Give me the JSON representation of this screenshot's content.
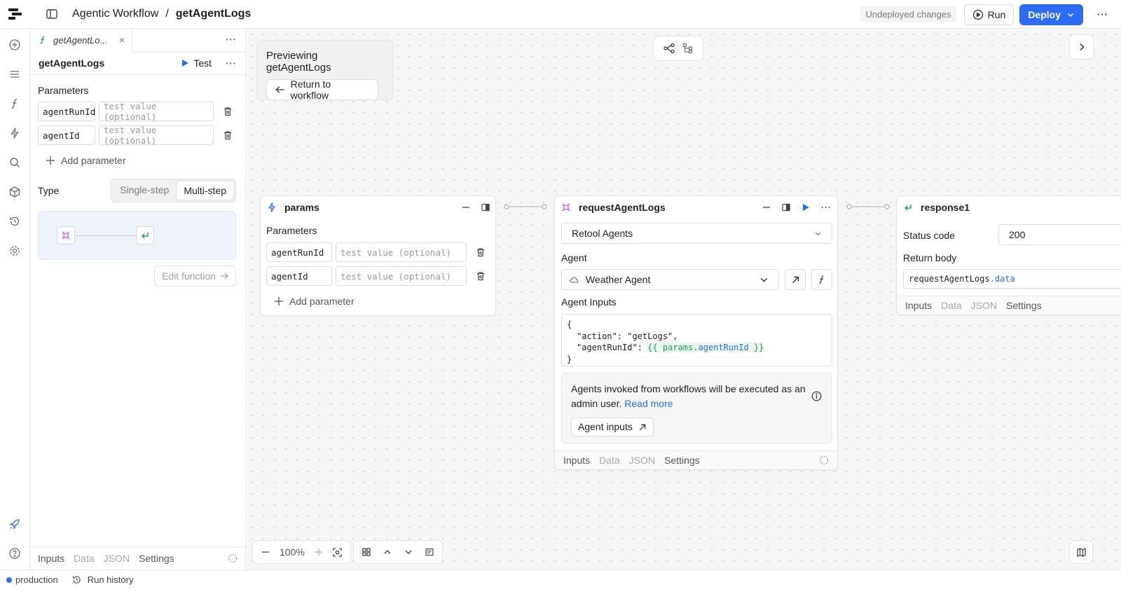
{
  "header": {
    "workflow_name": "Agentic Workflow",
    "separator": "/",
    "function_name": "getAgentLogs",
    "undeployed_label": "Undeployed changes",
    "run_label": "Run",
    "deploy_label": "Deploy",
    "more_label": "···"
  },
  "function_panel": {
    "tab_label": "getAgentLo...",
    "tab_close": "×",
    "tab_more": "···",
    "name": "getAgentLogs",
    "test_label": "Test",
    "more": "···",
    "parameters_label": "Parameters",
    "parameters": [
      {
        "name": "agentRunId",
        "placeholder": "test value (optional)"
      },
      {
        "name": "agentId",
        "placeholder": "test value (optional)"
      }
    ],
    "add_parameter_label": "Add parameter",
    "type_label": "Type",
    "type_options": [
      "Single-step",
      "Multi-step"
    ],
    "type_selected": "Multi-step",
    "edit_function_label": "Edit function",
    "bottom_tabs": [
      "Inputs",
      "Data",
      "JSON",
      "Settings"
    ]
  },
  "canvas": {
    "preview_title": "Previewing getAgentLogs",
    "return_label": "Return to workflow",
    "zoom": "100%"
  },
  "params_node": {
    "title": "params",
    "parameters_label": "Parameters",
    "parameters": [
      {
        "name": "agentRunId",
        "placeholder": "test value (optional)"
      },
      {
        "name": "agentId",
        "placeholder": "test value (optional)"
      }
    ],
    "add_parameter_label": "Add parameter"
  },
  "request_node": {
    "title": "requestAgentLogs",
    "resource": "Retool Agents",
    "agent_label": "Agent",
    "agent_value": "Weather Agent",
    "agent_inputs_label": "Agent Inputs",
    "code": {
      "open": "{",
      "line1": "\"action\": \"getLogs\",",
      "line2_key": "\"agentRunId\":",
      "tmpl_open": "{{",
      "tmpl_obj": "params",
      "tmpl_dot": ".",
      "tmpl_prop": "agentRunId",
      "tmpl_close": "}}",
      "close": "}"
    },
    "info_text": "Agents invoked from workflows will be executed as an admin user.",
    "info_link": "Read more",
    "agent_inputs_button": "Agent inputs",
    "tabs": [
      "Inputs",
      "Data",
      "JSON",
      "Settings"
    ]
  },
  "response_node": {
    "title": "response1",
    "status_code_label": "Status code",
    "status_code_value": "200",
    "return_body_label": "Return body",
    "return_body_obj": "requestAgentLogs",
    "return_body_dot": ".",
    "return_body_prop": "data",
    "tabs": [
      "Inputs",
      "Data",
      "JSON",
      "Settings"
    ]
  },
  "statusbar": {
    "environment": "production",
    "run_history": "Run history"
  },
  "colors": {
    "accent": "#2a6df4",
    "template_green": "#1b9e5a",
    "agent_pink": "#d66bd8",
    "environment_dot": "#2a6df4"
  },
  "icons": [
    "retool-logo-icon",
    "sidebar-toggle-icon",
    "play-circle-icon",
    "chevron-down-icon",
    "function-icon",
    "lightning-icon",
    "search-icon",
    "cube-icon",
    "history-icon",
    "gear-icon",
    "rocket-icon",
    "help-icon",
    "trash-icon",
    "plus-icon",
    "arrow-left-icon",
    "arrow-right-icon",
    "agent-icon",
    "return-icon",
    "external-link-icon",
    "info-icon",
    "minimize-icon",
    "split-panel-icon",
    "play-icon",
    "zoom-out-icon",
    "zoom-in-icon",
    "fit-screen-icon",
    "grid-icon",
    "chevron-up-icon",
    "note-icon",
    "map-icon",
    "collapse-icon",
    "spinner-icon"
  ]
}
